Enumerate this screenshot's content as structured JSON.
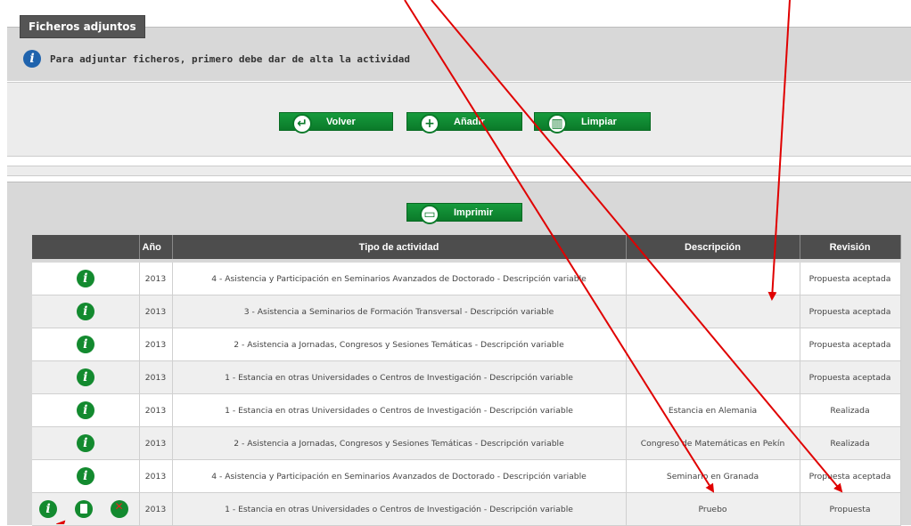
{
  "section": {
    "tab_label": "Ficheros adjuntos",
    "info_message": "Para adjuntar ficheros, primero debe dar de alta la actividad"
  },
  "buttons": {
    "volver": "Volver",
    "anadir": "Añadir",
    "limpiar": "Limpiar",
    "imprimir": "Imprimir"
  },
  "table": {
    "headers": {
      "actions": "",
      "year": "Año",
      "type": "Tipo de actividad",
      "description": "Descripción",
      "review": "Revisión"
    },
    "rows": [
      {
        "year": "2013",
        "type": "4 - Asistencia y Participación en Seminarios Avanzados de Doctorado - Descripción variable",
        "description": "",
        "review": "Propuesta aceptada"
      },
      {
        "year": "2013",
        "type": "3 - Asistencia a Seminarios de Formación Transversal - Descripción variable",
        "description": "",
        "review": "Propuesta aceptada"
      },
      {
        "year": "2013",
        "type": "2 - Asistencia a Jornadas, Congresos y Sesiones Temáticas - Descripción variable",
        "description": "",
        "review": "Propuesta aceptada"
      },
      {
        "year": "2013",
        "type": "1 - Estancia en otras Universidades o Centros de Investigación - Descripción variable",
        "description": "",
        "review": "Propuesta aceptada"
      },
      {
        "year": "2013",
        "type": "1 - Estancia en otras Universidades o Centros de Investigación - Descripción variable",
        "description": "Estancia en Alemania",
        "review": "Realizada"
      },
      {
        "year": "2013",
        "type": "2 - Asistencia a Jornadas, Congresos y Sesiones Temáticas - Descripción variable",
        "description": "Congreso de Matemáticas en Pekín",
        "review": "Realizada"
      },
      {
        "year": "2013",
        "type": "4 - Asistencia y Participación en Seminarios Avanzados de Doctorado - Descripción variable",
        "description": "Seminario en Granada",
        "review": "Propuesta aceptada"
      },
      {
        "year": "2013",
        "type": "1 - Estancia en otras Universidades o Centros de Investigación - Descripción variable",
        "description": "Pruebo",
        "review": "Propuesta"
      }
    ]
  },
  "colors": {
    "button_green": "#0b7a2a",
    "header_gray": "#4d4d4d",
    "annotation_red": "#e00000"
  }
}
